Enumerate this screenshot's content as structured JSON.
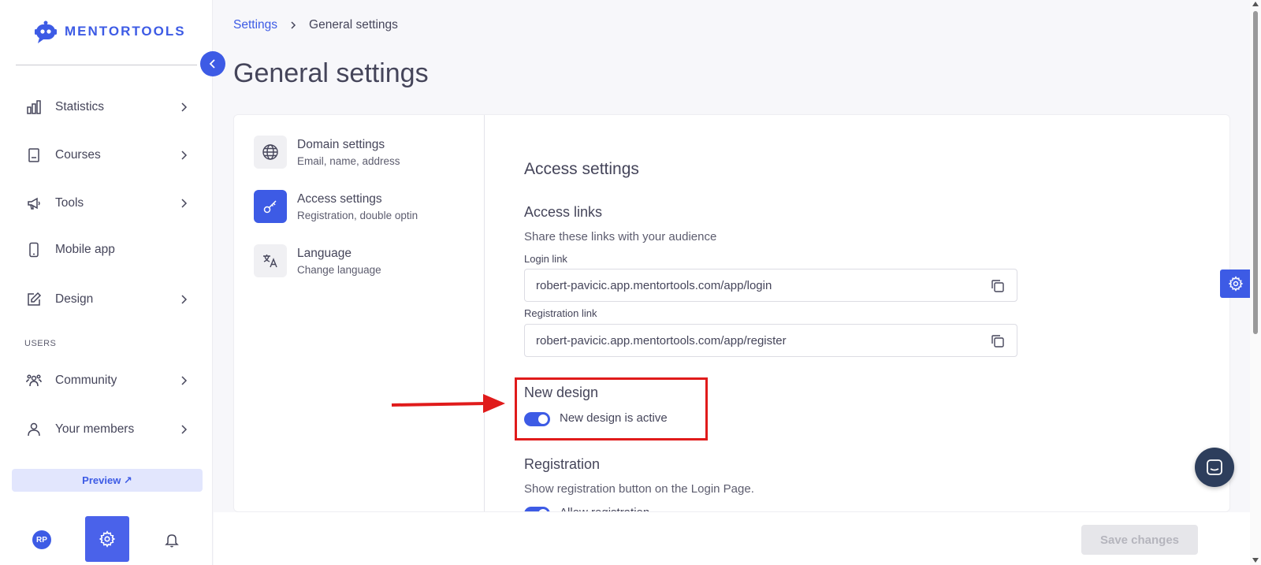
{
  "brand": {
    "name": "MENTORTOOLS",
    "accent": "#3d5be5"
  },
  "sidebar": {
    "items": [
      {
        "label": "Statistics",
        "icon": "bar-chart-icon",
        "has_chevron": true
      },
      {
        "label": "Courses",
        "icon": "book-icon",
        "has_chevron": true
      },
      {
        "label": "Tools",
        "icon": "megaphone-icon",
        "has_chevron": true
      },
      {
        "label": "Mobile app",
        "icon": "phone-icon",
        "has_chevron": false
      },
      {
        "label": "Design",
        "icon": "edit-icon",
        "has_chevron": true
      }
    ],
    "users_section_label": "USERS",
    "user_items": [
      {
        "label": "Community",
        "icon": "people-icon",
        "has_chevron": true
      },
      {
        "label": "Your members",
        "icon": "person-icon",
        "has_chevron": true
      }
    ],
    "preview_label": "Preview ↗",
    "avatar_initials": "RP"
  },
  "breadcrumb": {
    "parent": "Settings",
    "current": "General settings"
  },
  "page_title": "General settings",
  "settings_menu": [
    {
      "title": "Domain settings",
      "subtitle": "Email, name, address",
      "icon": "globe-icon",
      "active": false
    },
    {
      "title": "Access settings",
      "subtitle": "Registration, double optin",
      "icon": "key-icon",
      "active": true
    },
    {
      "title": "Language",
      "subtitle": "Change language",
      "icon": "translate-icon",
      "active": false
    }
  ],
  "content": {
    "section_title": "Access settings",
    "access_links": {
      "heading": "Access links",
      "description": "Share these links with your audience",
      "login_label": "Login link",
      "login_value": "robert-pavicic.app.mentortools.com/app/login",
      "register_label": "Registration link",
      "register_value": "robert-pavicic.app.mentortools.com/app/register"
    },
    "new_design": {
      "heading": "New design",
      "toggle_label": "New design is active",
      "enabled": true
    },
    "registration": {
      "heading": "Registration",
      "description": "Show registration button on the Login Page.",
      "toggle_label": "Allow registration",
      "enabled": true
    }
  },
  "footer": {
    "save_label": "Save changes"
  },
  "annotation_color": "#e01b1b"
}
